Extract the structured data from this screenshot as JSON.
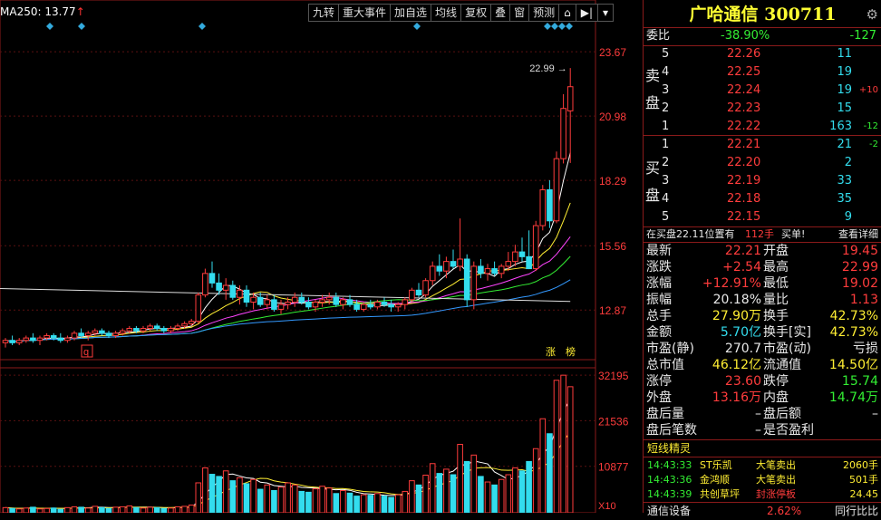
{
  "stock": {
    "name": "广哈通信",
    "code": "300711"
  },
  "ma_legend": {
    "label": "MA250: 13.77",
    "arrow": "↑"
  },
  "toolbar": [
    "九转",
    "重大事件",
    "加自选",
    "均线",
    "复权",
    "叠",
    "窗",
    "预测"
  ],
  "toolbar_icons": [
    "cube-icon",
    "jump-end-icon",
    "dropdown-icon"
  ],
  "price_axis": [
    "23.67",
    "20.98",
    "18.29",
    "15.56",
    "12.87"
  ],
  "vol_axis": [
    "32195",
    "21536",
    "10877"
  ],
  "vol_unit": "X10",
  "max_label": "22.99",
  "markers": {
    "q": "q",
    "zhang": "涨",
    "bang": "榜"
  },
  "order_book": {
    "weibi_label": "委比",
    "weibi": "-38.90%",
    "weicha": "-127",
    "sell_label": [
      "卖",
      "盘"
    ],
    "buy_label": [
      "买",
      "盘"
    ],
    "sell": [
      {
        "lvl": "5",
        "price": "22.26",
        "vol": "11",
        "chg": ""
      },
      {
        "lvl": "4",
        "price": "22.25",
        "vol": "19",
        "chg": ""
      },
      {
        "lvl": "3",
        "price": "22.24",
        "vol": "19",
        "chg": "+10"
      },
      {
        "lvl": "2",
        "price": "22.23",
        "vol": "15",
        "chg": ""
      },
      {
        "lvl": "1",
        "price": "22.22",
        "vol": "163",
        "chg": "-12"
      }
    ],
    "buy": [
      {
        "lvl": "1",
        "price": "22.21",
        "vol": "21",
        "chg": "-2"
      },
      {
        "lvl": "2",
        "price": "22.20",
        "vol": "2",
        "chg": ""
      },
      {
        "lvl": "3",
        "price": "22.19",
        "vol": "33",
        "chg": ""
      },
      {
        "lvl": "4",
        "price": "22.18",
        "vol": "35",
        "chg": ""
      },
      {
        "lvl": "5",
        "price": "22.15",
        "vol": "9",
        "chg": ""
      }
    ],
    "position_text": "在买盘22.11位置有",
    "position_qty": "112手",
    "position_side": "买单!",
    "detail_label": "查看详细"
  },
  "quote": [
    {
      "l1": "最新",
      "v1": "22.21",
      "c1": "red",
      "l2": "开盘",
      "v2": "19.45",
      "c2": "red"
    },
    {
      "l1": "涨跌",
      "v1": "+2.54",
      "c1": "red",
      "l2": "最高",
      "v2": "22.99",
      "c2": "red"
    },
    {
      "l1": "涨幅",
      "v1": "+12.91%",
      "c1": "red",
      "l2": "最低",
      "v2": "19.02",
      "c2": "red"
    },
    {
      "l1": "振幅",
      "v1": "20.18%",
      "c1": "white",
      "l2": "量比",
      "v2": "1.13",
      "c2": "red"
    },
    {
      "l1": "总手",
      "v1": "27.90万",
      "c1": "yellow",
      "l2": "换手",
      "v2": "42.73%",
      "c2": "yellow"
    },
    {
      "l1": "金额",
      "v1": "5.70亿",
      "c1": "cyan",
      "l2": "换手[实]",
      "v2": "42.73%",
      "c2": "yellow"
    },
    {
      "l1": "市盈(静)",
      "v1": "270.7",
      "c1": "white",
      "l2": "市盈(动)",
      "v2": "亏损",
      "c2": "white"
    },
    {
      "l1": "总市值",
      "v1": "46.12亿",
      "c1": "yellow",
      "l2": "流通值",
      "v2": "14.50亿",
      "c2": "yellow"
    },
    {
      "l1": "涨停",
      "v1": "23.60",
      "c1": "red",
      "l2": "跌停",
      "v2": "15.74",
      "c2": "green"
    },
    {
      "l1": "外盘",
      "v1": "13.16万",
      "c1": "red",
      "l2": "内盘",
      "v2": "14.74万",
      "c2": "green"
    },
    {
      "l1": "盘后量",
      "v1": "–",
      "c1": "white",
      "l2": "盘后额",
      "v2": "–",
      "c2": "white"
    },
    {
      "l1": "盘后笔数",
      "v1": "–",
      "c1": "white",
      "l2": "是否盈利",
      "v2": "",
      "c2": "white"
    }
  ],
  "short_line": {
    "title": "短线精灵",
    "items": [
      {
        "time": "14:43:33",
        "name": "ST乐凯",
        "event": "大笔卖出",
        "val": "2060手",
        "ec": "yellow"
      },
      {
        "time": "14:43:36",
        "name": "金鸿顺",
        "event": "大笔卖出",
        "val": "501手",
        "ec": "yellow"
      },
      {
        "time": "14:43:39",
        "name": "共创草坪",
        "event": "封涨停板",
        "val": "24.45",
        "ec": "red"
      }
    ]
  },
  "bottom": {
    "name": "通信设备",
    "pct": "2.62%",
    "rank": "同行比比"
  },
  "colors": {
    "up": "#ff3c3c",
    "down": "#33ddee",
    "border": "#8b1a1a"
  },
  "chart_data": {
    "type": "candlestick",
    "price_ticks": [
      23.67,
      20.98,
      18.29,
      15.56,
      12.87
    ],
    "vol_ticks": [
      32195,
      21536,
      10877
    ],
    "ylim": [
      10.87,
      24.7
    ],
    "vol_max": 33500,
    "candles": [
      [
        11.5,
        11.7,
        11.3,
        11.6
      ],
      [
        11.6,
        11.8,
        11.4,
        11.5
      ],
      [
        11.5,
        11.7,
        11.4,
        11.6
      ],
      [
        11.6,
        11.8,
        11.5,
        11.7
      ],
      [
        11.7,
        11.9,
        11.5,
        11.6
      ],
      [
        11.6,
        11.8,
        11.4,
        11.7
      ],
      [
        11.7,
        11.9,
        11.6,
        11.8
      ],
      [
        11.8,
        11.9,
        11.6,
        11.7
      ],
      [
        11.7,
        11.9,
        11.5,
        11.6
      ],
      [
        11.6,
        11.8,
        11.5,
        11.7
      ],
      [
        11.7,
        12.0,
        11.6,
        11.9
      ],
      [
        11.9,
        12.1,
        11.7,
        11.8
      ],
      [
        11.8,
        12.0,
        11.6,
        11.9
      ],
      [
        11.9,
        12.1,
        11.8,
        12.0
      ],
      [
        12.0,
        12.1,
        11.8,
        11.9
      ],
      [
        11.9,
        12.0,
        11.7,
        11.8
      ],
      [
        11.8,
        12.0,
        11.7,
        11.9
      ],
      [
        11.9,
        12.1,
        11.8,
        12.0
      ],
      [
        12.0,
        12.2,
        11.9,
        12.1
      ],
      [
        12.1,
        12.2,
        11.9,
        12.0
      ],
      [
        12.0,
        12.2,
        11.9,
        12.1
      ],
      [
        12.1,
        12.3,
        12.0,
        12.2
      ],
      [
        12.2,
        12.3,
        12.0,
        12.1
      ],
      [
        12.1,
        12.2,
        11.9,
        12.0
      ],
      [
        12.0,
        12.2,
        11.9,
        12.1
      ],
      [
        12.1,
        12.3,
        12.0,
        12.2
      ],
      [
        12.2,
        12.4,
        12.1,
        12.3
      ],
      [
        12.3,
        12.5,
        12.2,
        12.4
      ],
      [
        12.4,
        13.6,
        12.3,
        13.5
      ],
      [
        13.5,
        14.6,
        13.4,
        14.4
      ],
      [
        14.4,
        14.9,
        13.8,
        14.0
      ],
      [
        14.0,
        14.4,
        13.5,
        13.7
      ],
      [
        13.7,
        14.2,
        13.3,
        13.9
      ],
      [
        13.9,
        14.1,
        13.3,
        13.4
      ],
      [
        13.4,
        13.9,
        13.1,
        13.7
      ],
      [
        13.7,
        13.9,
        13.0,
        13.2
      ],
      [
        13.2,
        13.6,
        12.9,
        13.4
      ],
      [
        13.4,
        13.6,
        13.0,
        13.1
      ],
      [
        13.1,
        13.5,
        12.9,
        13.3
      ],
      [
        13.3,
        13.5,
        12.8,
        12.9
      ],
      [
        12.9,
        13.3,
        12.7,
        13.1
      ],
      [
        13.1,
        13.4,
        12.9,
        13.2
      ],
      [
        13.2,
        13.6,
        13.0,
        13.4
      ],
      [
        13.4,
        13.6,
        13.1,
        13.2
      ],
      [
        13.2,
        13.4,
        12.9,
        13.0
      ],
      [
        13.0,
        13.3,
        12.8,
        13.2
      ],
      [
        13.2,
        13.5,
        13.0,
        13.3
      ],
      [
        13.3,
        13.6,
        13.1,
        13.4
      ],
      [
        13.4,
        13.6,
        13.0,
        13.1
      ],
      [
        13.1,
        13.4,
        12.9,
        13.3
      ],
      [
        13.3,
        13.5,
        13.0,
        13.1
      ],
      [
        13.1,
        13.3,
        12.8,
        12.9
      ],
      [
        12.9,
        13.2,
        12.8,
        13.1
      ],
      [
        13.1,
        13.3,
        12.9,
        13.0
      ],
      [
        13.0,
        13.3,
        12.9,
        13.2
      ],
      [
        13.2,
        13.4,
        13.0,
        13.1
      ],
      [
        13.1,
        13.3,
        12.8,
        13.0
      ],
      [
        13.0,
        13.2,
        12.8,
        13.1
      ],
      [
        13.1,
        13.4,
        12.9,
        13.3
      ],
      [
        13.3,
        13.8,
        13.2,
        13.7
      ],
      [
        13.7,
        14.0,
        13.4,
        13.5
      ],
      [
        13.5,
        14.2,
        13.4,
        14.1
      ],
      [
        14.1,
        14.9,
        13.9,
        14.7
      ],
      [
        14.7,
        15.2,
        14.3,
        14.5
      ],
      [
        14.5,
        15.1,
        14.2,
        14.9
      ],
      [
        14.9,
        15.4,
        14.6,
        14.7
      ],
      [
        14.7,
        16.7,
        14.5,
        15.0
      ],
      [
        15.0,
        15.2,
        13.0,
        13.3
      ],
      [
        13.3,
        14.9,
        12.9,
        14.7
      ],
      [
        14.7,
        15.0,
        14.2,
        14.4
      ],
      [
        14.4,
        14.8,
        14.1,
        14.6
      ],
      [
        14.6,
        14.9,
        14.3,
        14.4
      ],
      [
        14.4,
        14.8,
        14.2,
        14.7
      ],
      [
        14.7,
        15.3,
        14.5,
        14.9
      ],
      [
        14.9,
        15.6,
        14.7,
        15.3
      ],
      [
        15.3,
        15.9,
        14.9,
        15.1
      ],
      [
        15.1,
        16.2,
        14.9,
        14.6
      ],
      [
        14.6,
        16.6,
        14.5,
        16.4
      ],
      [
        16.4,
        18.1,
        16.2,
        17.9
      ],
      [
        17.9,
        18.3,
        16.3,
        16.6
      ],
      [
        16.6,
        19.5,
        16.5,
        19.2
      ],
      [
        19.2,
        21.9,
        19.0,
        21.3
      ],
      [
        21.2,
        22.99,
        19.02,
        22.21
      ]
    ],
    "volumes": [
      1200,
      1000,
      900,
      1100,
      1300,
      900,
      1000,
      1100,
      800,
      1200,
      1400,
      1300,
      1100,
      1500,
      1200,
      1000,
      1300,
      1400,
      1600,
      1200,
      1100,
      1300,
      1200,
      1000,
      1100,
      1400,
      1500,
      1800,
      7000,
      10500,
      9000,
      8500,
      9800,
      7500,
      8200,
      6800,
      7800,
      5500,
      6500,
      5200,
      6000,
      7000,
      6500,
      5000,
      4800,
      5600,
      6200,
      5800,
      4500,
      5200,
      4600,
      3900,
      4200,
      4100,
      4500,
      3900,
      3600,
      4200,
      5000,
      7500,
      6500,
      8800,
      11500,
      9200,
      10200,
      8900,
      16000,
      12000,
      13500,
      8500,
      7200,
      6500,
      7800,
      8900,
      10500,
      9800,
      12000,
      15000,
      22000,
      18500,
      31000,
      32195,
      29500
    ]
  }
}
